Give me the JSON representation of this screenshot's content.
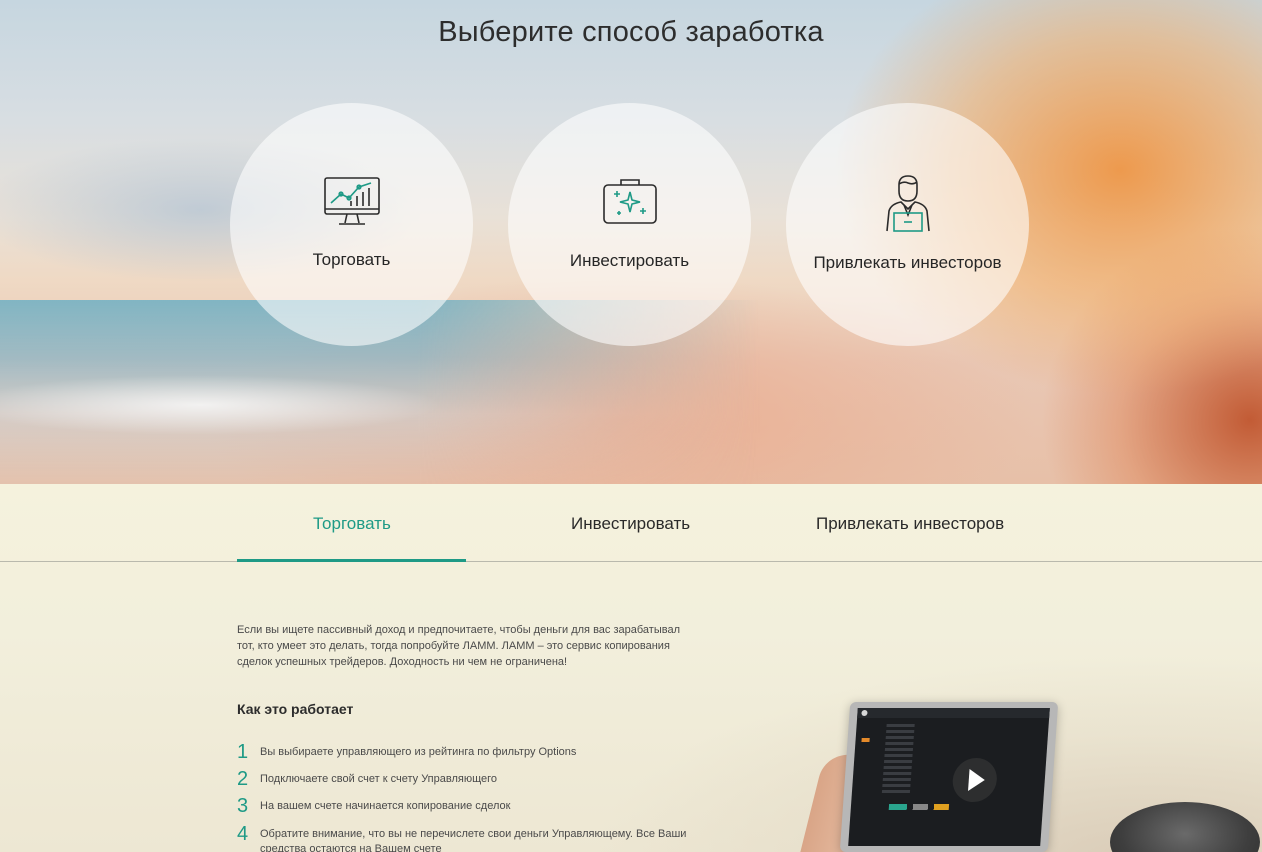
{
  "hero": {
    "title": "Выберите способ заработка",
    "options": [
      {
        "label": "Торговать",
        "icon": "chart-monitor-icon"
      },
      {
        "label": "Инвестировать",
        "icon": "briefcase-sparkle-icon"
      },
      {
        "label": "Привлекать инвесторов",
        "icon": "manager-laptop-icon"
      }
    ]
  },
  "tabs": {
    "items": [
      "Торговать",
      "Инвестировать",
      "Привлекать инвесторов"
    ],
    "active": "Торговать"
  },
  "content": {
    "intro": "Если вы ищете пассивный доход и предпочитаете, чтобы деньги для вас зарабатывал тот, кто умеет это делать, тогда попробуйте ЛАММ. ЛАММ – это сервис копирования сделок успешных трейдеров. Доходность ни чем не ограничена!",
    "how_title": "Как это работает",
    "steps": [
      {
        "num": "1",
        "text": "Вы выбираете управляющего из рейтинга по фильтру Options"
      },
      {
        "num": "2",
        "text": "Подключаете свой счет к счету Управляющего"
      },
      {
        "num": "3",
        "text": "На вашем счете начинается копирование сделок"
      },
      {
        "num": "4",
        "text": "Обратите внимание, что вы не перечислете свои деньги Управляющему. Все Ваши средства остаются на Вашем счете"
      }
    ]
  },
  "colors": {
    "accent": "#1e9a86",
    "text": "#2b2b2b"
  }
}
